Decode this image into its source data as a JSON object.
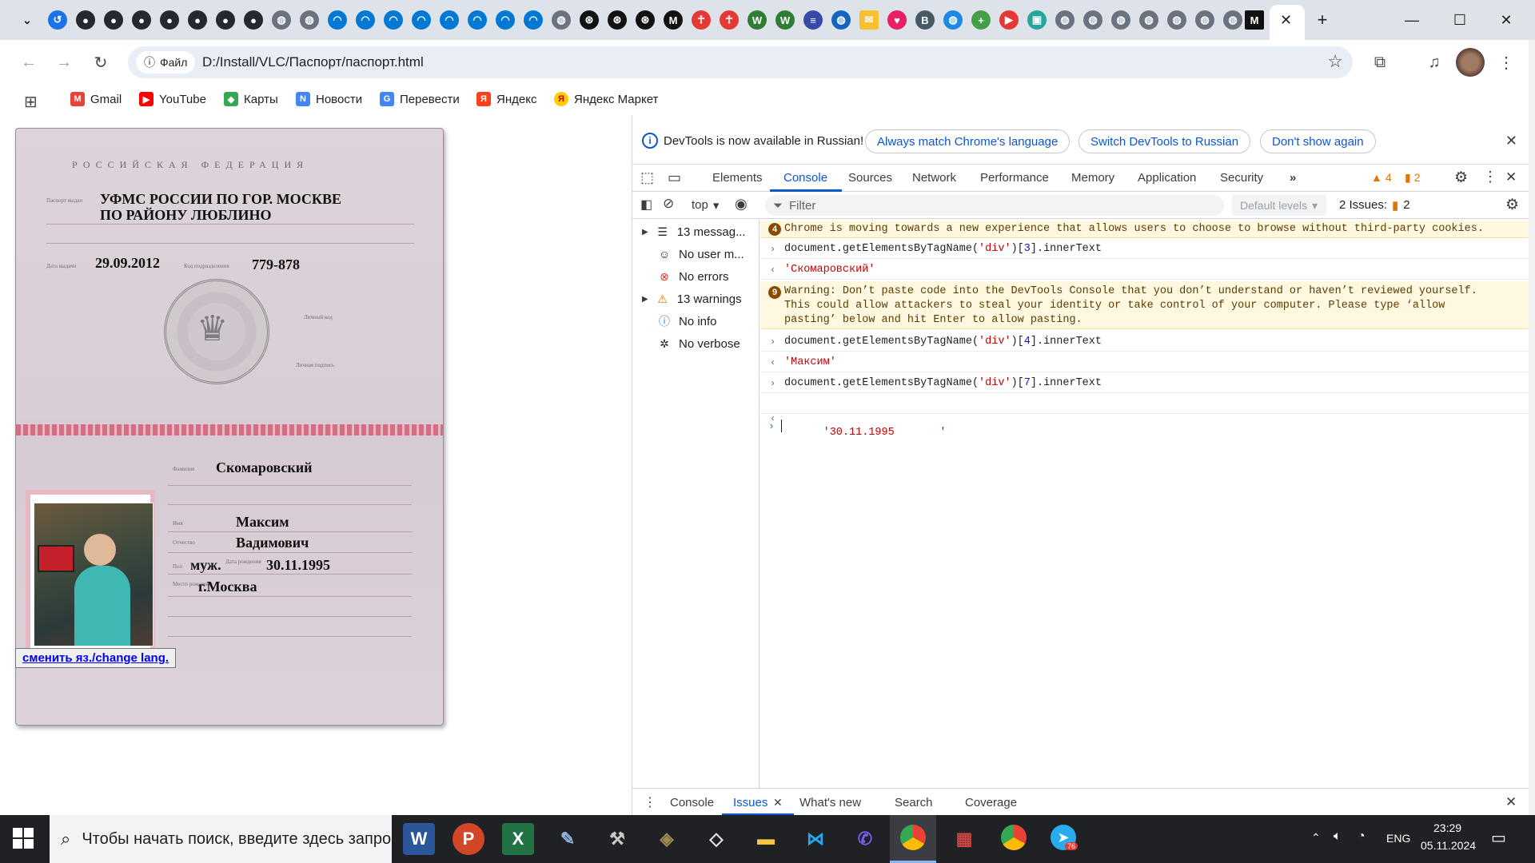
{
  "browser": {
    "address": {
      "chip_label": "Файл",
      "url": "D:/Install/VLC/Паспорт/паспорт.html"
    },
    "bookmarks": [
      {
        "label": "Gmail",
        "icon": "gmail-icon",
        "color": "#ea4335"
      },
      {
        "label": "YouTube",
        "icon": "youtube-icon",
        "color": "#ff0000"
      },
      {
        "label": "Карты",
        "icon": "maps-icon",
        "color": "#34a853"
      },
      {
        "label": "Новости",
        "icon": "news-icon",
        "color": "#4285f4"
      },
      {
        "label": "Перевести",
        "icon": "translate-icon",
        "color": "#4285f4"
      },
      {
        "label": "Яндекс",
        "icon": "yandex-icon",
        "color": "#fc3f1d"
      },
      {
        "label": "Яндекс Маркет",
        "icon": "yandex-market-icon",
        "color": "#ffcc00"
      }
    ]
  },
  "passport": {
    "header": "РОССИЙСКАЯ ФЕДЕРАЦИЯ",
    "issued_by_line1": "УФМС РОССИИ ПО ГОР. МОСКВЕ",
    "issued_by_line2": "ПО РАЙОНУ ЛЮБЛИНО",
    "issue_date": "29.09.2012",
    "division_code": "779-878",
    "surname": "Скомаровский",
    "first_name": "Максим",
    "patronymic": "Вадимович",
    "sex": "муж.",
    "birth_date": "30.11.1995",
    "birth_place": "г.Москва",
    "lang_button": "сменить яз./change lang."
  },
  "devtools": {
    "infobar": {
      "message": "DevTools is now available in Russian!",
      "btn_match": "Always match Chrome's language",
      "btn_switch": "Switch DevTools to Russian",
      "btn_dismiss": "Don't show again"
    },
    "tabs": [
      "Elements",
      "Console",
      "Sources",
      "Network",
      "Performance",
      "Memory",
      "Application",
      "Security"
    ],
    "active_tab": "Console",
    "warning_count": "4",
    "issue_count": "2",
    "filter": {
      "context": "top",
      "placeholder": "Filter",
      "levels": "Default levels",
      "issues_label": "2 Issues:",
      "issues_count": "2"
    },
    "sidebar": [
      {
        "label": "13 messag...",
        "icon": "list-icon"
      },
      {
        "label": "No user m...",
        "icon": "user-icon"
      },
      {
        "label": "No errors",
        "icon": "error-icon"
      },
      {
        "label": "13 warnings",
        "icon": "warning-icon"
      },
      {
        "label": "No info",
        "icon": "info-icon"
      },
      {
        "label": "No verbose",
        "icon": "bug-icon"
      }
    ],
    "console": {
      "msg1_count": "4",
      "msg1": "Chrome is moving towards a new experience that allows users to choose to browse without third-party cookies.",
      "cmd1_prefix": "document.getElementsByTagName(",
      "cmd1_arg": "'div'",
      "cmd1_mid": ")[",
      "cmd1_idx": "3",
      "cmd1_suffix": "].innerText",
      "res1": "'Скомаровский'",
      "msg2_count": "9",
      "msg2_line1": "Warning: Don’t paste code into the DevTools Console that you don’t understand or haven’t reviewed yourself.",
      "msg2_line2": "This could allow attackers to steal your identity or take control of your computer. Please type ‘allow",
      "msg2_line3": "pasting’ below and hit Enter to allow pasting.",
      "cmd2_idx": "4",
      "res2": "'Максим'",
      "cmd3_idx": "7",
      "res3": "'30.11.1995       '"
    },
    "drawer_tabs": [
      "Console",
      "Issues",
      "What's new",
      "Search",
      "Coverage"
    ],
    "drawer_active": "Issues"
  },
  "taskbar": {
    "search_placeholder": "Чтобы начать поиск, введите здесь запрос",
    "language": "ENG",
    "time": "23:29",
    "date": "05.11.2024",
    "telegram_badge": "76"
  },
  "colors": {
    "accent": "#0b57d0",
    "warning": "#e37400",
    "console_string": "#c80000"
  }
}
